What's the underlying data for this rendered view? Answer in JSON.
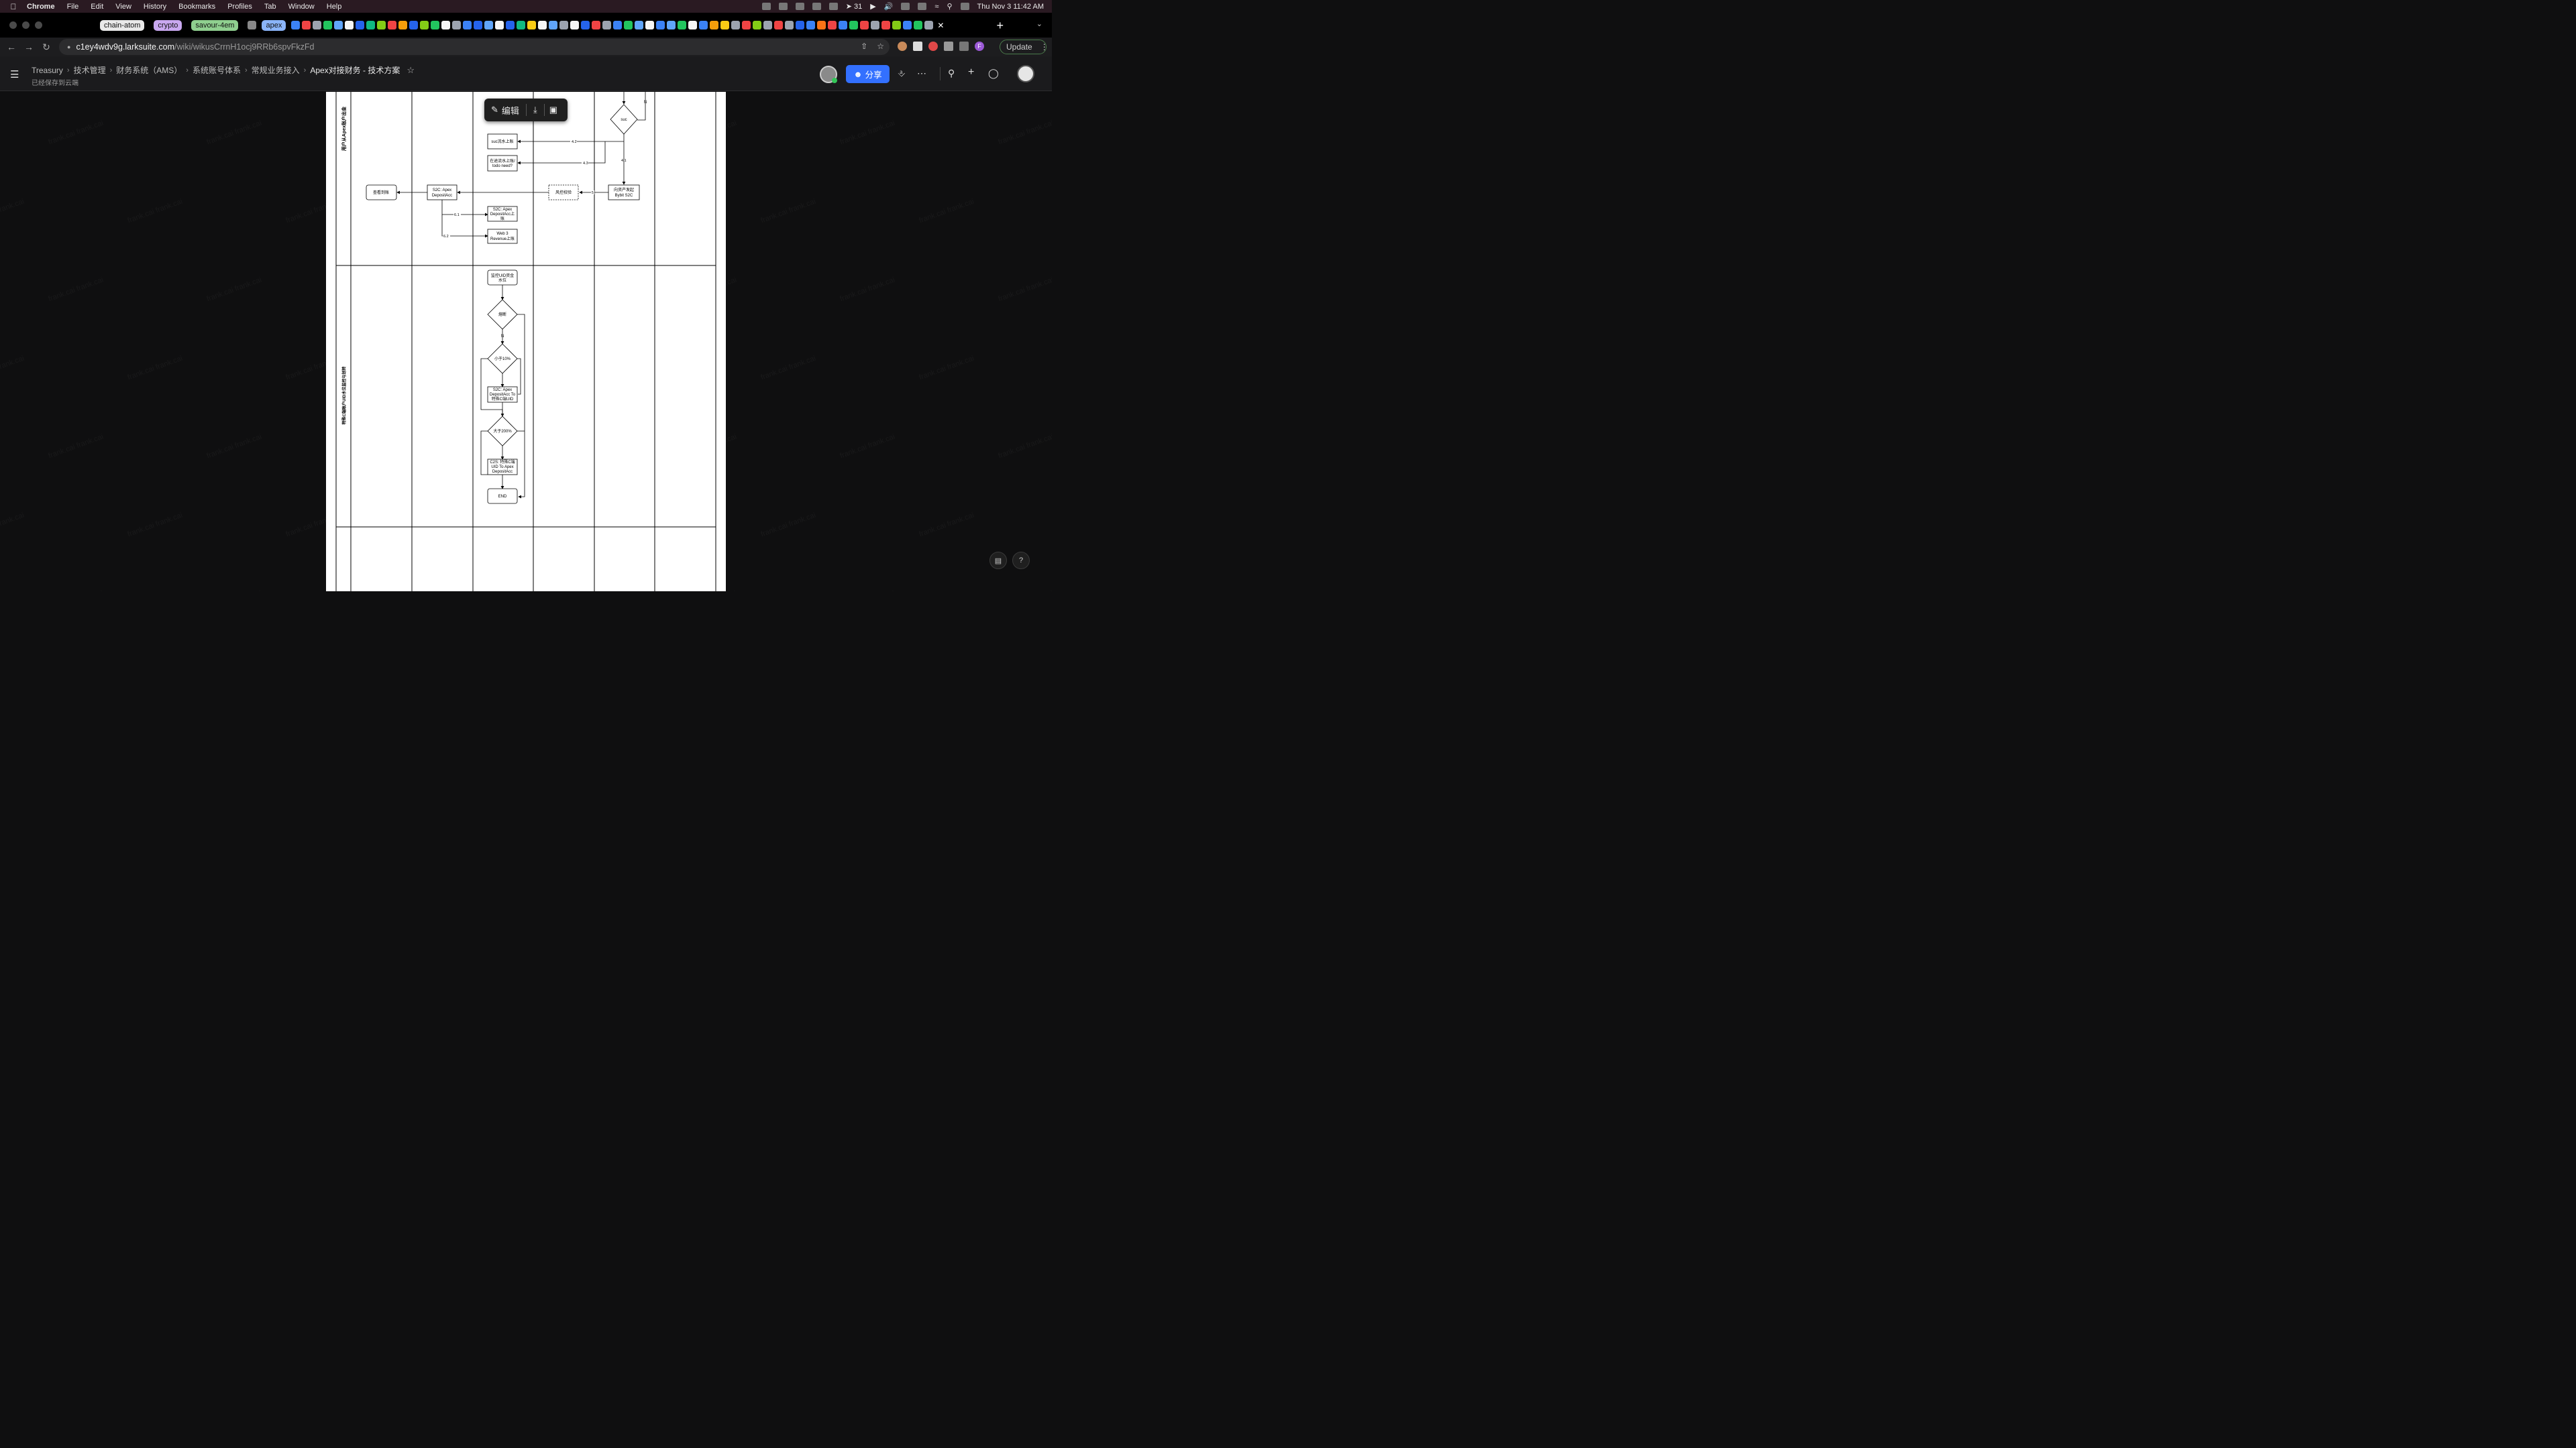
{
  "menubar": {
    "app": "Chrome",
    "items": [
      "File",
      "Edit",
      "View",
      "History",
      "Bookmarks",
      "Profiles",
      "Tab",
      "Window",
      "Help"
    ],
    "notif_count": "31",
    "clock": "Thu Nov 3  11:42 AM"
  },
  "tabs": {
    "groups": [
      {
        "label": "chain-atom",
        "color": "#e9e9e9"
      },
      {
        "label": "crypto",
        "color": "#c9a8f0"
      },
      {
        "label": "savour-4em",
        "color": "#8fcf8f"
      },
      {
        "label": "apex",
        "color": "#8ab4f8"
      }
    ]
  },
  "toolbar": {
    "url_host": "c1ey4wdv9g.larksuite.com",
    "url_path": "/wiki/wikusCrrnH1ocj9RRb6spvFkzFd",
    "update_label": "Update",
    "profile_initial": "F"
  },
  "doc": {
    "breadcrumb": [
      "Treasury",
      "技术管理",
      "财务系统（AMS）",
      "系统账号体系",
      "常规业务接入",
      "Apex对接财务 - 技术方案"
    ],
    "saved_status": "已经保存到云端",
    "share_label": "分享",
    "edit_label": "编辑",
    "watermark": "frank.cai"
  },
  "diagram": {
    "lane1_title": "用户从Apex账户出金",
    "lane2_title": "特殊C端账户UID水位监控与划转",
    "nodes": {
      "suc": "suc",
      "n": "N",
      "suc_ledger": "suc流水上账",
      "transit_1": "在途流水上账/",
      "transit_2": "todo need?",
      "check_arrival": "查看到账",
      "s2c_apex_1": "S2C: Apex",
      "s2c_apex_2": "DepositAcc",
      "risk_check": "风控校验",
      "initiate_1": "向资产发起",
      "initiate_2": "Bybit S2C",
      "s2c_dep_1": "S2C: Apex",
      "s2c_dep_2": "DepositAcc上",
      "s2c_dep_3": "账",
      "web3_1": "Web 3",
      "web3_2": "Revenue上账",
      "monitor_1": "监控UID资金",
      "monitor_2": "水位",
      "judge": "熔断",
      "n2": "N",
      "lt10": "小于10%",
      "s2c_to_1": "S2C: Apex",
      "s2c_to_2": "DepositAcc To",
      "s2c_to_3": "特殊C端UID",
      "gt200": "大于200%",
      "c2s_1": "C2S: 特殊C端",
      "c2s_2": "UID To Apex",
      "c2s_3": "DepositAcc",
      "end": "END"
    },
    "edge_labels": {
      "e42": "4.2",
      "e43": "4.3",
      "e41": "4.1",
      "e5": "5",
      "e61": "6.1",
      "e62": "6.2"
    }
  }
}
